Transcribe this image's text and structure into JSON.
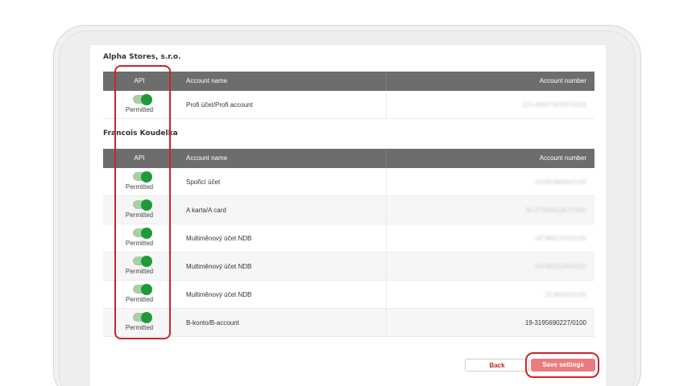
{
  "section1": {
    "company": "Alpha Stores, s.r.o.",
    "headers": {
      "api": "API",
      "name": "Account name",
      "number": "Account number"
    },
    "rows": [
      {
        "status": "Permitted",
        "name": "Profi účet/Profi account",
        "number": "115-4380730297/0100",
        "blurred": true,
        "enabled": true
      }
    ]
  },
  "section2": {
    "company": "Francois Koudelka",
    "headers": {
      "api": "API",
      "name": "Account name",
      "number": "Account number"
    },
    "rows": [
      {
        "status": "Permitted",
        "name": "Spořicí účet",
        "number": "1059538664/0100",
        "blurred": true,
        "enabled": true
      },
      {
        "status": "Permitted",
        "name": "A karta/A card",
        "number": "35-2795341357/0100",
        "blurred": true,
        "enabled": true
      },
      {
        "status": "Permitted",
        "name": "Multiměnový účet NDB",
        "number": "1479852241/0100",
        "blurred": true,
        "enabled": true
      },
      {
        "status": "Permitted",
        "name": "Multiměnový účet NDB",
        "number": "1479852245/0100",
        "blurred": true,
        "enabled": true
      },
      {
        "status": "Permitted",
        "name": "Multiměnový účet NDB",
        "number": "2238405/0100",
        "blurred": true,
        "enabled": true
      },
      {
        "status": "Permitted",
        "name": "B-konto/B-account",
        "number": "19-3195690227/0100",
        "blurred": false,
        "enabled": true
      }
    ]
  },
  "actions": {
    "back_label": "Back",
    "save_label": "Save settings"
  },
  "colors": {
    "header_bg": "#6d6d6d",
    "toggle_on": "#1f9a3a",
    "primary_button": "#ea7b7e",
    "highlight_outline": "#c9252c"
  }
}
